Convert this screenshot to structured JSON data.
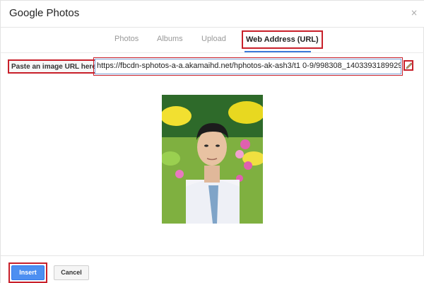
{
  "dialog": {
    "title": "Google Photos",
    "close_icon": "×"
  },
  "tabs": [
    {
      "label": "Photos"
    },
    {
      "label": "Albums"
    },
    {
      "label": "Upload"
    },
    {
      "label": "Web Address (URL)",
      "selected": true
    }
  ],
  "url_section": {
    "label": "Paste an image URL here:",
    "input_value": "https://fbcdn-sphotos-a-a.akamaihd.net/hphotos-ak-ash3/t1 0-9/998308_1403393189929",
    "edit_icon": "pencil-icon"
  },
  "preview": {
    "icon": "photo-preview"
  },
  "footer": {
    "insert_label": "Insert",
    "cancel_label": "Cancel"
  },
  "colors": {
    "highlight_box": "#c8202a",
    "insert_button": "#4d8ff1",
    "tab_underline": "#3b78d8"
  }
}
